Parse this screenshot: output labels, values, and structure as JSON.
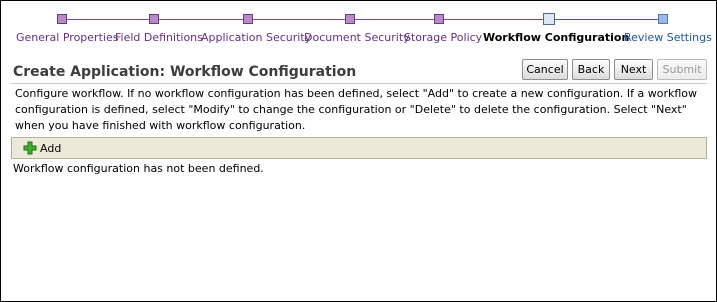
{
  "train": {
    "steps": [
      {
        "label": "General Properties",
        "state": "visited"
      },
      {
        "label": "Field Definitions",
        "state": "visited"
      },
      {
        "label": "Application Security",
        "state": "visited"
      },
      {
        "label": "Document Security",
        "state": "visited"
      },
      {
        "label": "Storage Policy",
        "state": "visited"
      },
      {
        "label": "Workflow Configuration",
        "state": "current"
      },
      {
        "label": "Review Settings",
        "state": "future"
      }
    ]
  },
  "header": {
    "title": "Create Application: Workflow Configuration",
    "buttons": {
      "cancel": "Cancel",
      "back": "Back",
      "next": "Next",
      "submit": "Submit"
    }
  },
  "description": "Configure workflow. If no workflow configuration has been defined, select \"Add\" to create a new configuration. If a workflow configuration is defined, select \"Modify\" to change the configuration or \"Delete\" to delete the configuration. Select \"Next\" when you have finished with workflow configuration.",
  "toolbar": {
    "add_label": "Add",
    "add_icon": "plus-icon"
  },
  "empty_message": "Workflow configuration has not been defined.",
  "colors": {
    "visited": "#6a2d86",
    "future": "#1f55a5",
    "toolbar_bg": "#ece9d8"
  }
}
